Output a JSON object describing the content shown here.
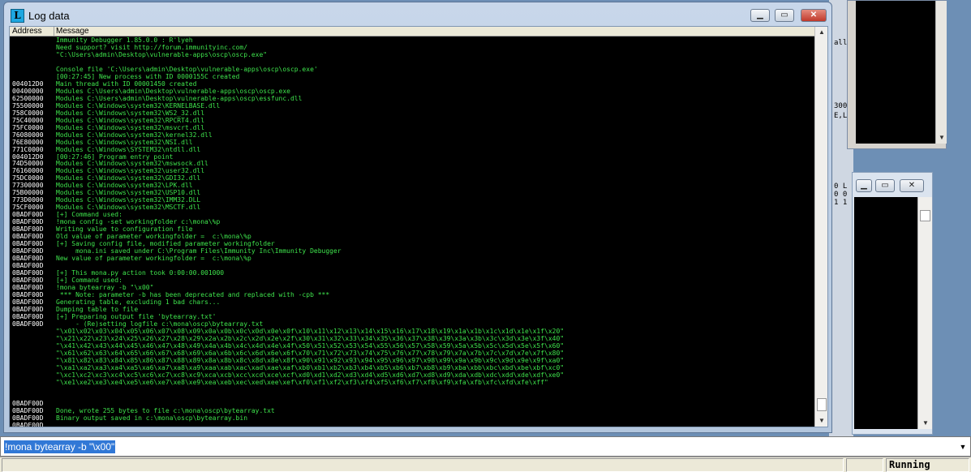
{
  "window": {
    "title": "Log data",
    "icon_letter": "L",
    "minimize_icon": "minimize-icon",
    "maximize_icon": "maximize-icon",
    "close_icon": "close-icon"
  },
  "columns": {
    "address": "Address",
    "message": "Message"
  },
  "log_rows": [
    [
      "",
      "Immunity Debugger 1.85.0.0 : R'lyeh"
    ],
    [
      "",
      "Need support? visit http://forum.immunityinc.com/"
    ],
    [
      "",
      "\"C:\\Users\\admin\\Desktop\\vulnerable-apps\\oscp\\oscp.exe\""
    ],
    [
      "",
      ""
    ],
    [
      "",
      "Console file 'C:\\Users\\admin\\Desktop\\vulnerable-apps\\oscp\\oscp.exe'"
    ],
    [
      "",
      "[00:27:45] New process with ID 0000155C created"
    ],
    [
      "004012D0",
      "Main thread with ID 00001450 created"
    ],
    [
      "00400000",
      "Modules C:\\Users\\admin\\Desktop\\vulnerable-apps\\oscp\\oscp.exe"
    ],
    [
      "62500000",
      "Modules C:\\Users\\admin\\Desktop\\vulnerable-apps\\oscp\\essfunc.dll"
    ],
    [
      "75500000",
      "Modules C:\\Windows\\system32\\KERNELBASE.dll"
    ],
    [
      "758C0000",
      "Modules C:\\Windows\\system32\\WS2_32.dll"
    ],
    [
      "75C40000",
      "Modules C:\\Windows\\system32\\RPCRT4.dll"
    ],
    [
      "75FC0000",
      "Modules C:\\Windows\\system32\\msvcrt.dll"
    ],
    [
      "76080000",
      "Modules C:\\Windows\\system32\\kernel32.dll"
    ],
    [
      "76E80000",
      "Modules C:\\Windows\\system32\\NSI.dll"
    ],
    [
      "771C0000",
      "Modules C:\\Windows\\SYSTEM32\\ntdll.dll"
    ],
    [
      "004012D0",
      "[00:27:46] Program entry point"
    ],
    [
      "74D50000",
      "Modules C:\\Windows\\system32\\mswsock.dll"
    ],
    [
      "76160000",
      "Modules C:\\Windows\\system32\\user32.dll"
    ],
    [
      "75DC0000",
      "Modules C:\\Windows\\system32\\GDI32.dll"
    ],
    [
      "77300000",
      "Modules C:\\Windows\\system32\\LPK.dll"
    ],
    [
      "75B00000",
      "Modules C:\\Windows\\system32\\USP10.dll"
    ],
    [
      "773D0000",
      "Modules C:\\Windows\\system32\\IMM32.DLL"
    ],
    [
      "75CF0000",
      "Modules C:\\Windows\\system32\\MSCTF.dll"
    ],
    [
      "0BADF00D",
      "[+] Command used:"
    ],
    [
      "0BADF00D",
      "!mona config -set workingfolder c:\\mona\\%p"
    ],
    [
      "0BADF00D",
      "Writing value to configuration file"
    ],
    [
      "0BADF00D",
      "Old value of parameter workingfolder =  c:\\mona\\%p"
    ],
    [
      "0BADF00D",
      "[+] Saving config file, modified parameter workingfolder"
    ],
    [
      "0BADF00D",
      "     mona.ini saved under C:\\Program Files\\Immunity Inc\\Immunity Debugger"
    ],
    [
      "0BADF00D",
      "New value of parameter workingfolder =  c:\\mona\\%p"
    ],
    [
      "0BADF00D",
      ""
    ],
    [
      "0BADF00D",
      "[+] This mona.py action took 0:00:00.001000"
    ],
    [
      "0BADF00D",
      "[+] Command used:"
    ],
    [
      "0BADF00D",
      "!mona bytearray -b \"\\x00\""
    ],
    [
      "0BADF00D",
      " *** Note: parameter -b has been deprecated and replaced with -cpb ***"
    ],
    [
      "0BADF00D",
      "Generating table, excluding 1 bad chars..."
    ],
    [
      "0BADF00D",
      "Dumping table to file"
    ],
    [
      "0BADF00D",
      "[+] Preparing output file 'bytearray.txt'"
    ],
    [
      "0BADF00D",
      "     - (Re)setting logfile c:\\mona\\oscp\\bytearray.txt"
    ],
    [
      "",
      "\"\\x01\\x02\\x03\\x04\\x05\\x06\\x07\\x08\\x09\\x0a\\x0b\\x0c\\x0d\\x0e\\x0f\\x10\\x11\\x12\\x13\\x14\\x15\\x16\\x17\\x18\\x19\\x1a\\x1b\\x1c\\x1d\\x1e\\x1f\\x20\""
    ],
    [
      "",
      "\"\\x21\\x22\\x23\\x24\\x25\\x26\\x27\\x28\\x29\\x2a\\x2b\\x2c\\x2d\\x2e\\x2f\\x30\\x31\\x32\\x33\\x34\\x35\\x36\\x37\\x38\\x39\\x3a\\x3b\\x3c\\x3d\\x3e\\x3f\\x40\""
    ],
    [
      "",
      "\"\\x41\\x42\\x43\\x44\\x45\\x46\\x47\\x48\\x49\\x4a\\x4b\\x4c\\x4d\\x4e\\x4f\\x50\\x51\\x52\\x53\\x54\\x55\\x56\\x57\\x58\\x59\\x5a\\x5b\\x5c\\x5d\\x5e\\x5f\\x60\""
    ],
    [
      "",
      "\"\\x61\\x62\\x63\\x64\\x65\\x66\\x67\\x68\\x69\\x6a\\x6b\\x6c\\x6d\\x6e\\x6f\\x70\\x71\\x72\\x73\\x74\\x75\\x76\\x77\\x78\\x79\\x7a\\x7b\\x7c\\x7d\\x7e\\x7f\\x80\""
    ],
    [
      "",
      "\"\\x81\\x82\\x83\\x84\\x85\\x86\\x87\\x88\\x89\\x8a\\x8b\\x8c\\x8d\\x8e\\x8f\\x90\\x91\\x92\\x93\\x94\\x95\\x96\\x97\\x98\\x99\\x9a\\x9b\\x9c\\x9d\\x9e\\x9f\\xa0\""
    ],
    [
      "",
      "\"\\xa1\\xa2\\xa3\\xa4\\xa5\\xa6\\xa7\\xa8\\xa9\\xaa\\xab\\xac\\xad\\xae\\xaf\\xb0\\xb1\\xb2\\xb3\\xb4\\xb5\\xb6\\xb7\\xb8\\xb9\\xba\\xbb\\xbc\\xbd\\xbe\\xbf\\xc0\""
    ],
    [
      "",
      "\"\\xc1\\xc2\\xc3\\xc4\\xc5\\xc6\\xc7\\xc8\\xc9\\xca\\xcb\\xcc\\xcd\\xce\\xcf\\xd0\\xd1\\xd2\\xd3\\xd4\\xd5\\xd6\\xd7\\xd8\\xd9\\xda\\xdb\\xdc\\xdd\\xde\\xdf\\xe0\""
    ],
    [
      "",
      "\"\\xe1\\xe2\\xe3\\xe4\\xe5\\xe6\\xe7\\xe8\\xe9\\xea\\xeb\\xec\\xed\\xee\\xef\\xf0\\xf1\\xf2\\xf3\\xf4\\xf5\\xf6\\xf7\\xf8\\xf9\\xfa\\xfb\\xfc\\xfd\\xfe\\xff\""
    ],
    [
      "",
      ""
    ],
    [
      "",
      ""
    ],
    [
      "0BADF00D",
      ""
    ],
    [
      "0BADF00D",
      "Done, wrote 255 bytes to file c:\\mona\\oscp\\bytearray.txt"
    ],
    [
      "0BADF00D",
      "Binary output saved in c:\\mona\\oscp\\bytearray.bin"
    ],
    [
      "0BADF00D",
      ""
    ],
    [
      "0BADF00D",
      "[+] This mona.py action took 0:00:00.025000"
    ]
  ],
  "scrollbar": {
    "up_icon": "scroll-up-icon",
    "down_icon": "scroll-down-icon"
  },
  "command_bar": {
    "value": "!mona bytearray -b \"\\x00\"",
    "dropdown_icon": "dropdown-arrow-icon"
  },
  "status": {
    "state": "Running"
  },
  "background": {
    "strip_texts": [
      "all",
      "300",
      "E,L",
      "0 L",
      "0 0",
      "1 1"
    ]
  },
  "colors": {
    "log_text": "#3ee34c",
    "address_text": "#ffffff",
    "log_background": "#000000",
    "selection": "#3178d6"
  }
}
